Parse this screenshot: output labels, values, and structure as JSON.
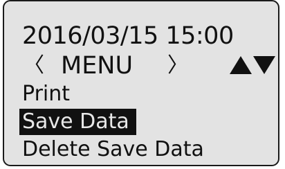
{
  "header": {
    "datetime": "2016/03/15  15:00"
  },
  "menu": {
    "prev_glyph": "〈",
    "title": "MENU",
    "next_glyph": "〉",
    "scroll_icons": [
      "triangle-up-icon",
      "triangle-down-icon"
    ]
  },
  "items": [
    {
      "label": "Print",
      "selected": false
    },
    {
      "label": "Save Data",
      "selected": true
    },
    {
      "label": "Delete Save Data",
      "selected": false
    }
  ],
  "colors": {
    "lcd_background": "#e3e3e3",
    "text": "#111111",
    "highlight_background": "#111111",
    "highlight_text": "#e8e8e8"
  }
}
